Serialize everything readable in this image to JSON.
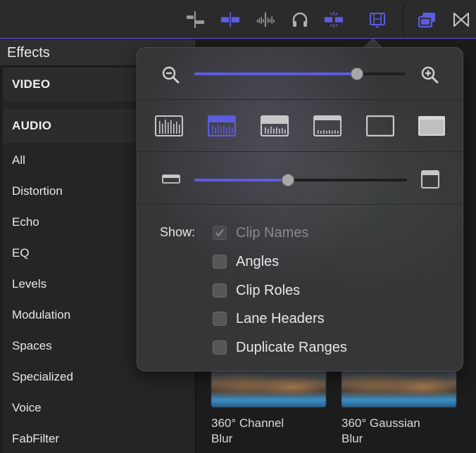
{
  "toolbar": {
    "accent": "#5c5ce0",
    "icons": [
      "clip-connect-icon",
      "clip-skimming-icon",
      "audio-skimming-icon",
      "headphones-icon",
      "snapping-icon",
      "clip-appearance-icon",
      "window-layout-icon",
      "transitions-icon"
    ]
  },
  "effects": {
    "title": "Effects",
    "sections": [
      "VIDEO",
      "AUDIO"
    ],
    "items": [
      "All",
      "Distortion",
      "Echo",
      "EQ",
      "Levels",
      "Modulation",
      "Spaces",
      "Specialized",
      "Voice",
      "FabFilter"
    ]
  },
  "browser": {
    "thumbnails": [
      {
        "label_line1": "360° Channel",
        "label_line2": "Blur"
      },
      {
        "label_line1": "360° Gaussian",
        "label_line2": "Blur"
      }
    ]
  },
  "popover": {
    "zoom_value": 0.77,
    "clip_height_value": 0.44,
    "clip_styles": [
      "waveform-only",
      "large-waveform",
      "waveform-filmstrip",
      "filmstrip-small-waveform",
      "filmstrip-only",
      "name-only"
    ],
    "selected_clip_style": "large-waveform",
    "show_label": "Show:",
    "options": [
      {
        "label": "Clip Names",
        "checked": true,
        "disabled": true
      },
      {
        "label": "Angles",
        "checked": false,
        "disabled": false
      },
      {
        "label": "Clip Roles",
        "checked": false,
        "disabled": false
      },
      {
        "label": "Lane Headers",
        "checked": false,
        "disabled": false
      },
      {
        "label": "Duplicate Ranges",
        "checked": false,
        "disabled": false
      }
    ]
  }
}
